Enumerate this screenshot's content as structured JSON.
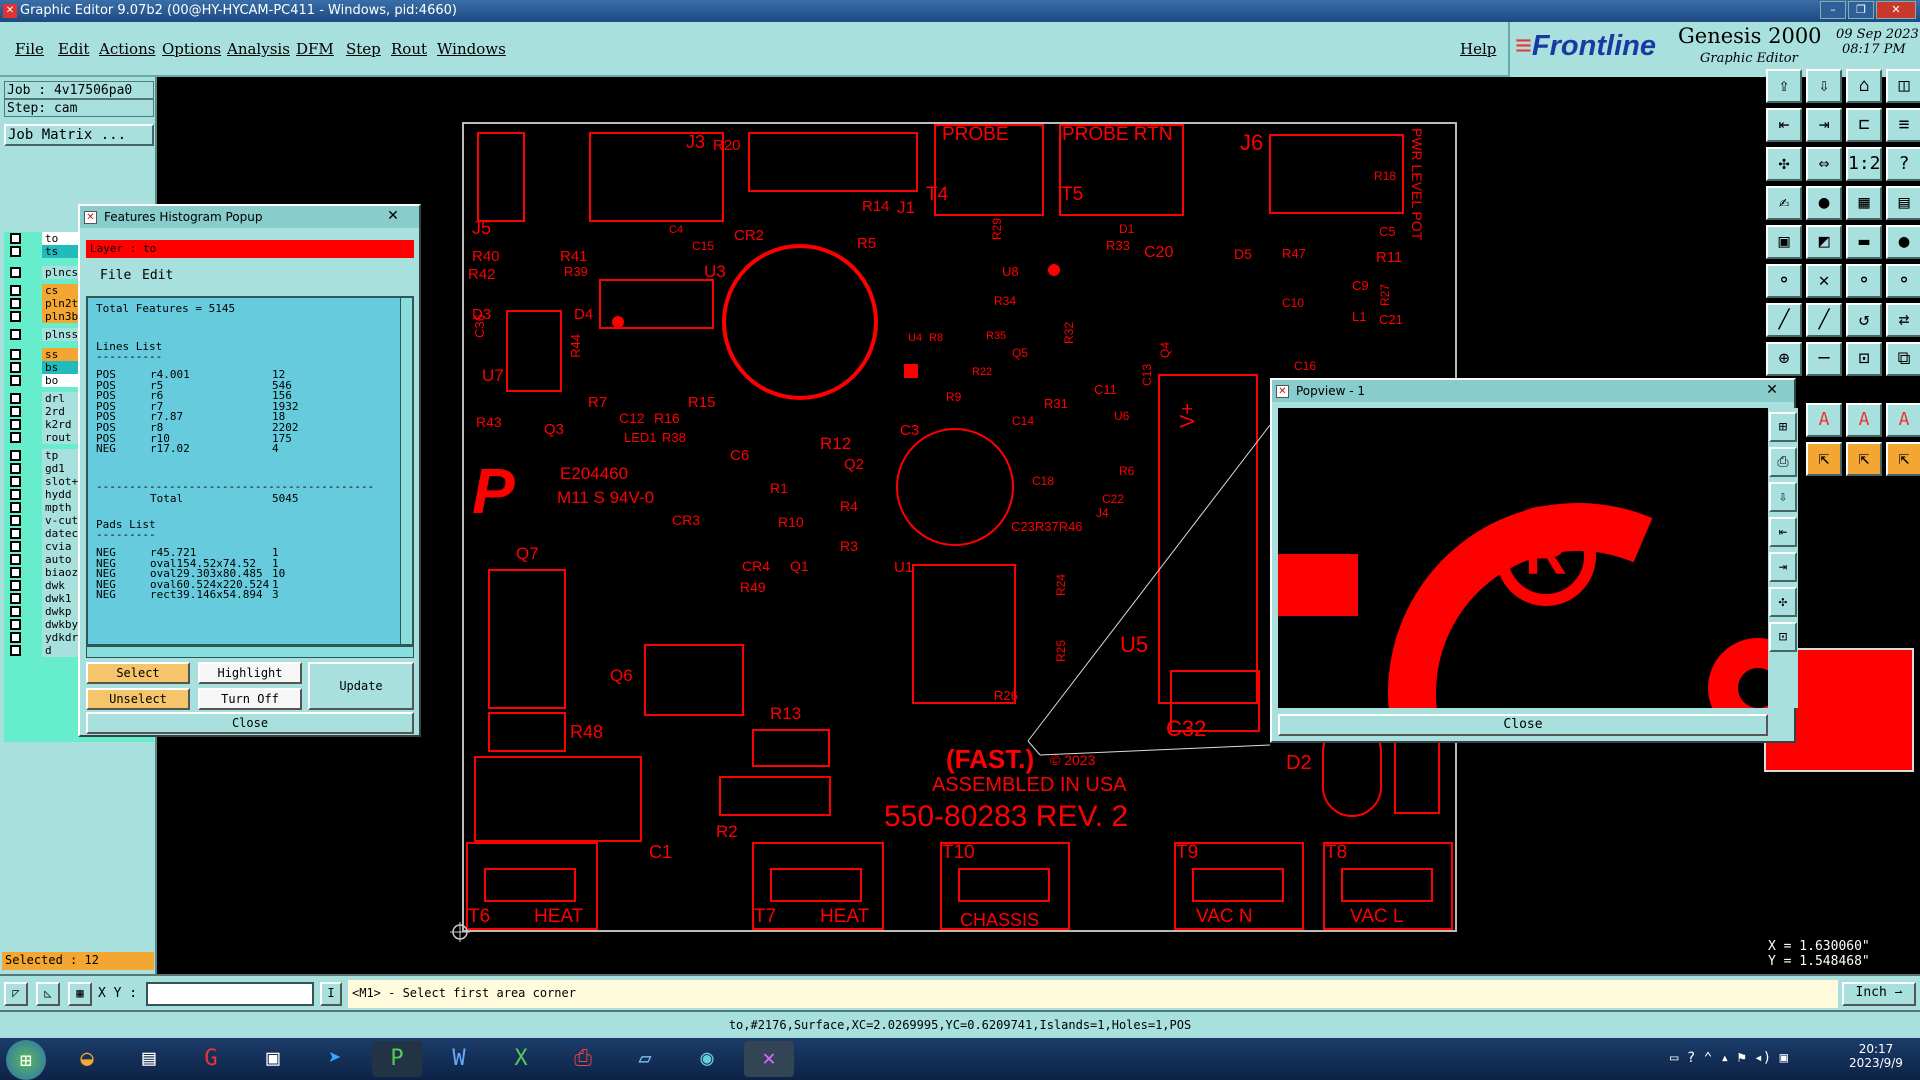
{
  "window": {
    "title": "Graphic Editor 9.07b2 (00@HY-HYCAM-PC411 - Windows, pid:4660)"
  },
  "menu": {
    "items": [
      "File",
      "Edit",
      "Actions",
      "Options",
      "Analysis",
      "DFM",
      "Step",
      "Rout",
      "Windows"
    ],
    "help": "Help"
  },
  "brand": {
    "logo": "Frontline",
    "product": "Genesis 2000",
    "subtitle": "Graphic Editor",
    "date": "09 Sep 2023",
    "time": "08:17 PM"
  },
  "left": {
    "job": "Job : 4v17506pa0",
    "step": "Step: cam",
    "job_matrix": "Job Matrix ...",
    "layers": [
      "to",
      "ts",
      "plncs",
      "cs",
      "pln2t",
      "pln3b",
      "plnss",
      "ss",
      "bs",
      "bo",
      "drl",
      "2rd",
      "k2rd",
      "rout",
      "tp",
      "gd1",
      "slot+",
      "hydd",
      "mpth",
      "v-cut",
      "datec",
      "cvia",
      "auto",
      "biaoz",
      "dwk",
      "dwk1",
      "dwkp",
      "dwkby",
      "ydkdr",
      "d"
    ],
    "selected": "Selected : 12"
  },
  "histogram": {
    "title": "Features Histogram Popup",
    "layer_label": "Layer : to",
    "menu": [
      "File",
      "Edit"
    ],
    "total": "Total Features = 5145",
    "lines_header": "Lines List",
    "lines": [
      [
        "POS",
        "r4.001",
        "12"
      ],
      [
        "POS",
        "r5",
        "546"
      ],
      [
        "POS",
        "r6",
        "156"
      ],
      [
        "POS",
        "r7",
        "1932"
      ],
      [
        "POS",
        "r7.87",
        "18"
      ],
      [
        "POS",
        "r8",
        "2202"
      ],
      [
        "POS",
        "r10",
        "175"
      ],
      [
        "NEG",
        "r17.02",
        "4"
      ]
    ],
    "lines_total_label": "Total",
    "lines_total": "5045",
    "pads_header": "Pads List",
    "pads": [
      [
        "NEG",
        "r45.721",
        "1"
      ],
      [
        "NEG",
        "oval154.52x74.52",
        "1"
      ],
      [
        "NEG",
        "oval29.303x80.485",
        "10"
      ],
      [
        "NEG",
        "oval60.524x220.524",
        "1"
      ],
      [
        "NEG",
        "rect39.146x54.894",
        "3"
      ]
    ],
    "buttons": {
      "select": "Select",
      "highlight": "Highlight",
      "update": "Update",
      "unselect": "Unselect",
      "turnoff": "Turn Off",
      "close": "Close"
    }
  },
  "popview": {
    "title": "Popview - 1",
    "close": "Close"
  },
  "pcb_labels": {
    "probe": "PROBE",
    "probe_rtn": "PROBE RTN",
    "t4": "T4",
    "t5": "T5",
    "j6": "J6",
    "j3": "J3",
    "r20": "R20",
    "j1": "J1",
    "j5": "J5",
    "r40": "R40",
    "r41": "R41",
    "r42": "R42",
    "r39": "R39",
    "u3": "U3",
    "r14": "R14",
    "r5": "R5",
    "cr2": "CR2",
    "c4": "C4",
    "c15": "C15",
    "d1": "D1",
    "r33": "R33",
    "c20": "C20",
    "d5": "D5",
    "r47": "R47",
    "r11": "R11",
    "c5": "C5",
    "r18": "R18",
    "pwr": "PWR LEVEL POT",
    "d3": "D3",
    "d4": "D4",
    "c36": "C36",
    "u7": "U7",
    "r44": "R44",
    "r7": "R7",
    "c12": "C12",
    "r16": "R16",
    "r15": "R15",
    "r43": "R43",
    "q3": "Q3",
    "led1": "LED1",
    "r38": "R38",
    "c6": "C6",
    "r12": "R12",
    "q2": "Q2",
    "c3": "C3",
    "ul": "E204460",
    "m11": "M11 S 94V-0",
    "cr3": "CR3",
    "r1": "R1",
    "r10": "R10",
    "r4": "R4",
    "r3": "R3",
    "cr4": "CR4",
    "q1": "Q1",
    "r49": "R49",
    "u1": "U1",
    "q7": "Q7",
    "q6": "Q6",
    "r48": "R48",
    "r13": "R13",
    "r2": "R2",
    "c1": "C1",
    "fast": "(FAST.)",
    "copy": "© 2023",
    "assembled": "ASSEMBLED IN USA",
    "part": "550-80283 REV. 2",
    "u5": "U5",
    "vplus": "V+",
    "c32": "C32",
    "d2": "D2",
    "r26": "R26",
    "t6": "T6",
    "heat1": "HEAT",
    "t7": "T7",
    "heat2": "HEAT",
    "t10": "T10",
    "chassis": "CHASSIS",
    "t9": "T9",
    "vacn": "VAC N",
    "t8": "T8",
    "vacl": "VAC L",
    "c9": "C9",
    "l1": "L1",
    "c21": "C21",
    "c10": "C10",
    "c16": "C16",
    "c11": "C11",
    "c13": "C13",
    "c14": "C14",
    "c18": "C18",
    "c22": "C22",
    "j4": "J4",
    "r31": "R31",
    "r37r46": "C23R37R46",
    "r6": "R6",
    "r24": "R24",
    "r25": "R25",
    "u6": "U6",
    "u8": "U8",
    "r34": "R34",
    "r29": "R29",
    "q5": "Q5",
    "r32": "R32",
    "u4": "U4",
    "r8": "R8",
    "r35": "R35",
    "r27": "R27",
    "r9": "R9",
    "q4": "Q4",
    "r22": "R22"
  },
  "coords": {
    "x": "X = 1.630060\"",
    "y": "Y = 1.548468\""
  },
  "command": {
    "xy_label": "X Y :",
    "xy_value": "",
    "prompt": "<M1> - Select first area corner",
    "units": "Inch"
  },
  "status": "to,#2176,Surface,XC=2.0269995,YC=0.6209741,Islands=1,Holes=1,POS",
  "taskbar": {
    "time": "20:17",
    "date": "2023/9/9"
  }
}
